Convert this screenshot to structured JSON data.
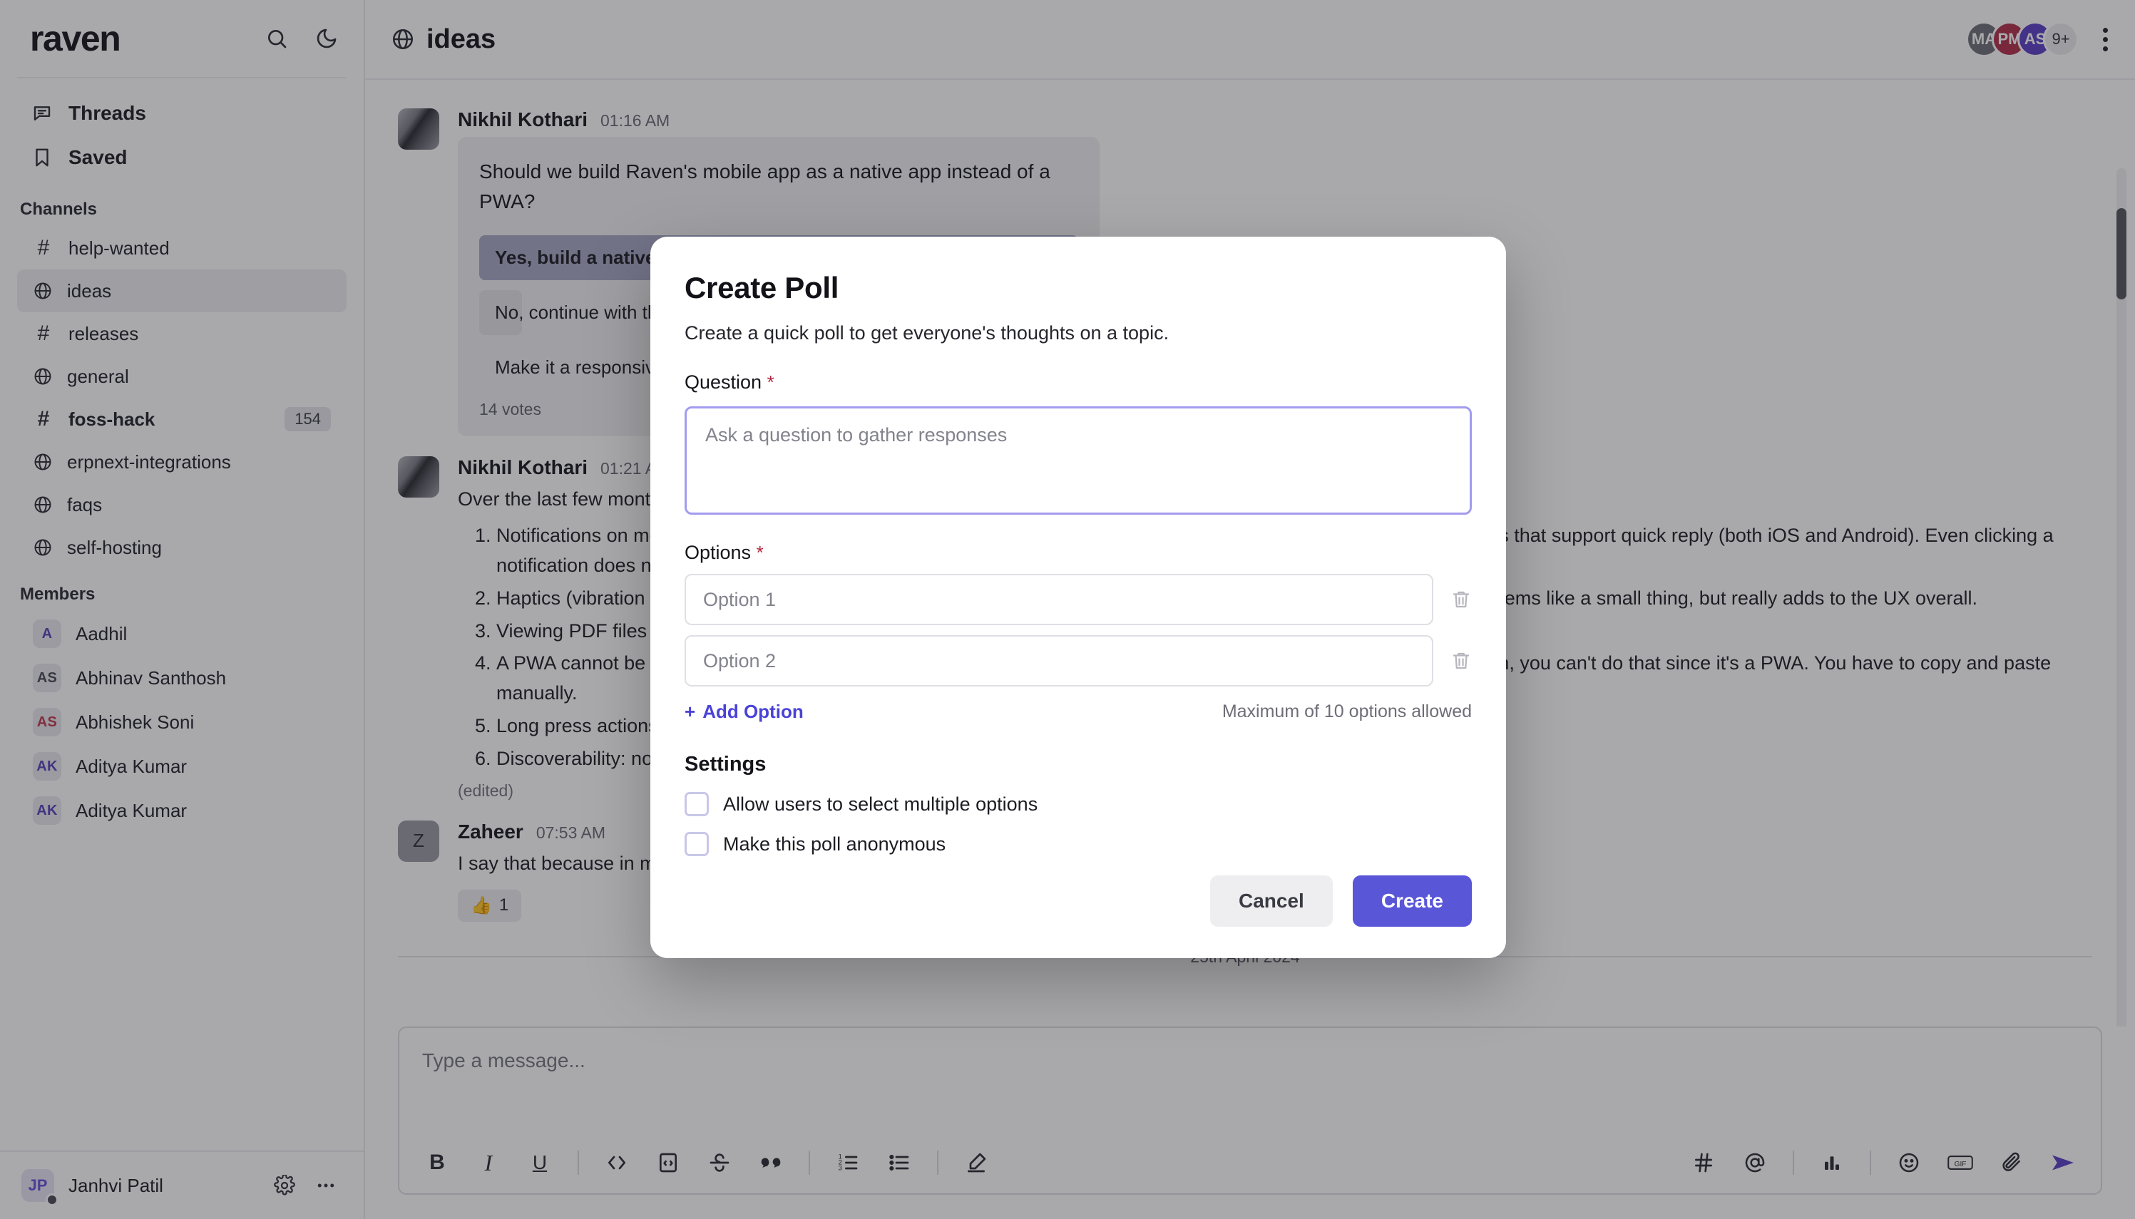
{
  "sidebar": {
    "brand": "raven",
    "search_icon": "search-icon",
    "theme_icon": "moon-icon",
    "nav": [
      {
        "label": "Threads",
        "icon": "threads-icon"
      },
      {
        "label": "Saved",
        "icon": "bookmark-icon"
      }
    ],
    "channels_heading": "Channels",
    "channels": [
      {
        "name": "help-wanted",
        "kind": "hash",
        "badge": "",
        "unread": false,
        "active": false
      },
      {
        "name": "ideas",
        "kind": "globe",
        "badge": "",
        "unread": false,
        "active": true
      },
      {
        "name": "releases",
        "kind": "hash",
        "badge": "",
        "unread": false,
        "active": false
      },
      {
        "name": "general",
        "kind": "globe",
        "badge": "",
        "unread": false,
        "active": false
      },
      {
        "name": "foss-hack",
        "kind": "hash",
        "badge": "154",
        "unread": true,
        "active": false
      },
      {
        "name": "erpnext-integrations",
        "kind": "globe",
        "badge": "",
        "unread": false,
        "active": false
      },
      {
        "name": "faqs",
        "kind": "globe",
        "badge": "",
        "unread": false,
        "active": false
      },
      {
        "name": "self-hosting",
        "kind": "globe",
        "badge": "",
        "unread": false,
        "active": false
      }
    ],
    "members_heading": "Members",
    "members": [
      {
        "name": "Aadhil",
        "initials": "A",
        "color": "#5b43b8"
      },
      {
        "name": "Abhinav Santhosh",
        "initials": "AS",
        "color": "#4a4a55"
      },
      {
        "name": "Abhishek Soni",
        "initials": "AS",
        "color": "#c0394b"
      },
      {
        "name": "Aditya Kumar",
        "initials": "AK",
        "color": "#5b43b8"
      },
      {
        "name": "Aditya Kumar",
        "initials": "AK",
        "color": "#5b43b8"
      }
    ],
    "current_user": {
      "name": "Janhvi Patil",
      "initials": "JP"
    },
    "settings_icon": "gear-icon",
    "more_icon": "ellipsis-icon"
  },
  "header": {
    "channel_icon": "globe-icon",
    "channel_name": "ideas",
    "avatars": [
      {
        "initials": "MA",
        "color": "#6f6f76"
      },
      {
        "initials": "PM",
        "color": "#b03048"
      },
      {
        "initials": "AS",
        "color": "#5b3fc4"
      }
    ],
    "overflow_count": "9+",
    "menu_icon": "kebab-menu-icon"
  },
  "messages": [
    {
      "author": "Nikhil Kothari",
      "time": "01:16 AM",
      "avatar_kind": "photo",
      "poll": {
        "question": "Should we build Raven's mobile app as a native app instead of a PWA?",
        "options": [
          {
            "label": "Yes, build a native app",
            "leading": true
          },
          {
            "label": "No, continue with the PWA",
            "leading": false
          },
          {
            "label": "Make it a responsive web app",
            "leading": false
          }
        ],
        "votes": "14 votes"
      }
    },
    {
      "author": "Nikhil Kothari",
      "time": "01:21 AM",
      "avatar_kind": "photo",
      "intro": "Over the last few months I've been using Raven on mobile and here are some issues I have faced:",
      "items": [
        "Notifications on mobile: you cannot reply from the notification itself like you can in WhatsApp / Slack / other native apps that support quick reply (both iOS and Android). Even clicking a notification does not work reliably on iOS.",
        "Haptics (vibration feedback) when you send a message, react, or perform an action are not possible in a PWA. This seems like a small thing, but really adds to the UX overall.",
        "Viewing PDF files and other documents inline is broken on iOS Safari inside a PWA.",
        "A PWA cannot be registered as a share target on iOS — so if you are in another app and you want to “share” on Raven, you can't do that since it's a PWA. You have to copy and paste manually.",
        "Long press actions and gestures feel much more responsive in a native app than a PWA.",
        "Discoverability: nobody searches for a PWA — people search the App Store."
      ],
      "edited": "(edited)"
    },
    {
      "author": "Zaheer",
      "time": "07:53 AM",
      "avatar_kind": "initials",
      "avatar_initials": "Z",
      "text": "I say that because in my experience most teams care about the developers, not the users",
      "reaction": {
        "emoji": "👍",
        "count": "1"
      }
    }
  ],
  "date_separator": "25th April 2024",
  "composer": {
    "placeholder": "Type a message...",
    "left_tools": [
      {
        "name": "bold-icon",
        "glyph": "B"
      },
      {
        "name": "italic-icon",
        "glyph": "I"
      },
      {
        "name": "underline-icon",
        "glyph": "U"
      },
      {
        "name": "code-icon",
        "glyph": "</>"
      },
      {
        "name": "code-block-icon",
        "glyph": "⌨"
      },
      {
        "name": "strikethrough-icon",
        "glyph": "S"
      },
      {
        "name": "blockquote-icon",
        "glyph": "”"
      },
      {
        "name": "ordered-list-icon",
        "glyph": "1."
      },
      {
        "name": "bullet-list-icon",
        "glyph": "•"
      },
      {
        "name": "highlight-icon",
        "glyph": "✎"
      }
    ],
    "right_tools": [
      {
        "name": "channel-mention-icon",
        "glyph": "#"
      },
      {
        "name": "user-mention-icon",
        "glyph": "@"
      },
      {
        "name": "create-poll-icon",
        "glyph": "bars"
      },
      {
        "name": "emoji-picker-icon",
        "glyph": "☺"
      },
      {
        "name": "gif-picker-icon",
        "glyph": "GIF"
      },
      {
        "name": "attachment-icon",
        "glyph": "📎"
      },
      {
        "name": "send-icon",
        "glyph": "➤"
      }
    ]
  },
  "modal": {
    "title": "Create Poll",
    "subtitle": "Create a quick poll to get everyone's thoughts on a topic.",
    "question_label": "Question",
    "required_mark": "*",
    "question_placeholder": "Ask a question to gather responses",
    "question_value": "",
    "options_label": "Options",
    "options": [
      {
        "placeholder": "Option 1",
        "value": ""
      },
      {
        "placeholder": "Option 2",
        "value": ""
      }
    ],
    "add_option_label": "Add Option",
    "add_option_plus": "+",
    "max_note": "Maximum of 10 options allowed",
    "settings_label": "Settings",
    "checkboxes": [
      {
        "label": "Allow users to select multiple options",
        "checked": false
      },
      {
        "label": "Make this poll anonymous",
        "checked": false
      }
    ],
    "cancel_label": "Cancel",
    "create_label": "Create",
    "accent_color": "#5956d8",
    "link_color": "#4a43d6"
  }
}
